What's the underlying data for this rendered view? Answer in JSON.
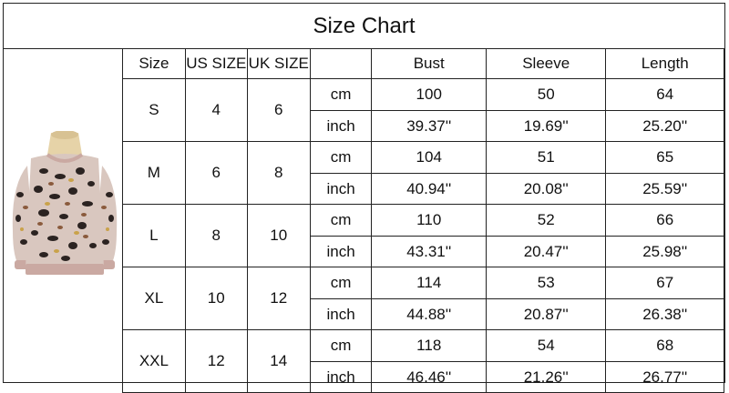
{
  "title": "Size Chart",
  "headers": {
    "size": "Size",
    "us": "US SIZE",
    "uk": "UK SIZE",
    "unit": "",
    "bust": "Bust",
    "sleeve": "Sleeve",
    "length": "Length"
  },
  "rows": [
    {
      "size": "S",
      "us": "4",
      "uk": "6",
      "cm": {
        "unit": "cm",
        "bust": "100",
        "sleeve": "50",
        "length": "64"
      },
      "inch": {
        "unit": "inch",
        "bust": "39.37''",
        "sleeve": "19.69''",
        "length": "25.20''"
      }
    },
    {
      "size": "M",
      "us": "6",
      "uk": "8",
      "cm": {
        "unit": "cm",
        "bust": "104",
        "sleeve": "51",
        "length": "65"
      },
      "inch": {
        "unit": "inch",
        "bust": "40.94''",
        "sleeve": "20.08''",
        "length": "25.59''"
      }
    },
    {
      "size": "L",
      "us": "8",
      "uk": "10",
      "cm": {
        "unit": "cm",
        "bust": "110",
        "sleeve": "52",
        "length": "66"
      },
      "inch": {
        "unit": "inch",
        "bust": "43.31''",
        "sleeve": "20.47''",
        "length": "25.98''"
      }
    },
    {
      "size": "XL",
      "us": "10",
      "uk": "12",
      "cm": {
        "unit": "cm",
        "bust": "114",
        "sleeve": "53",
        "length": "67"
      },
      "inch": {
        "unit": "inch",
        "bust": "44.88''",
        "sleeve": "20.87''",
        "length": "26.38''"
      }
    },
    {
      "size": "XXL",
      "us": "12",
      "uk": "14",
      "cm": {
        "unit": "cm",
        "bust": "118",
        "sleeve": "54",
        "length": "68"
      },
      "inch": {
        "unit": "inch",
        "bust": "46.46''",
        "sleeve": "21.26''",
        "length": "26.77''"
      }
    }
  ],
  "colors": {
    "border": "#222222",
    "sweater_base": "#d9c7bf",
    "spot_dark": "#2b2321",
    "spot_brown": "#8a5a3c",
    "spot_mustard": "#c9a24a",
    "hem": "#caa9a2",
    "mannequin": "#e6d3a8"
  }
}
